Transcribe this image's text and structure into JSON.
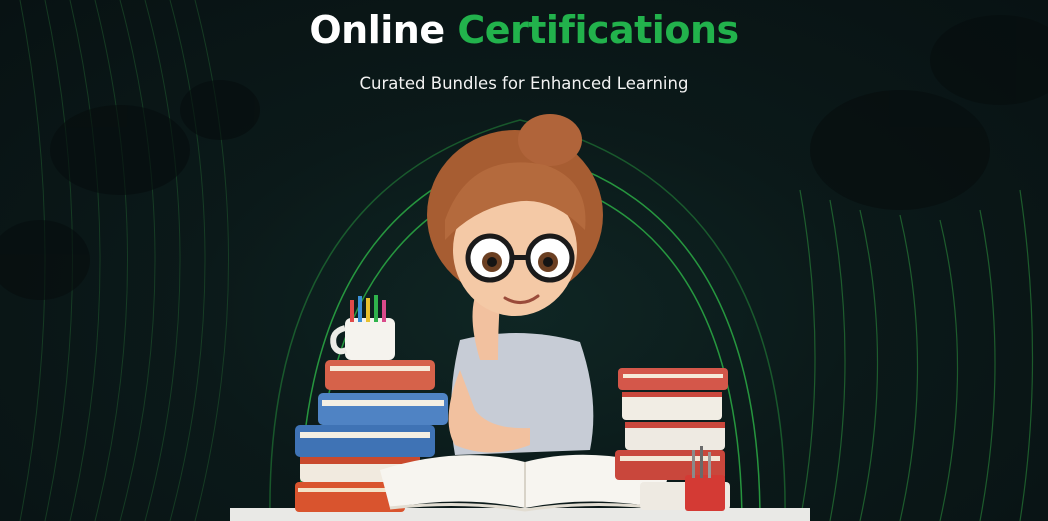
{
  "hero": {
    "title_white": "Online",
    "title_green": "Certifications",
    "subtitle": "Curated Bundles for Enhanced Learning"
  },
  "colors": {
    "background": "#0b1718",
    "accent_green": "#22b24c",
    "title_white": "#ffffff"
  },
  "illustration": {
    "subject": "student-with-books-illustration"
  }
}
